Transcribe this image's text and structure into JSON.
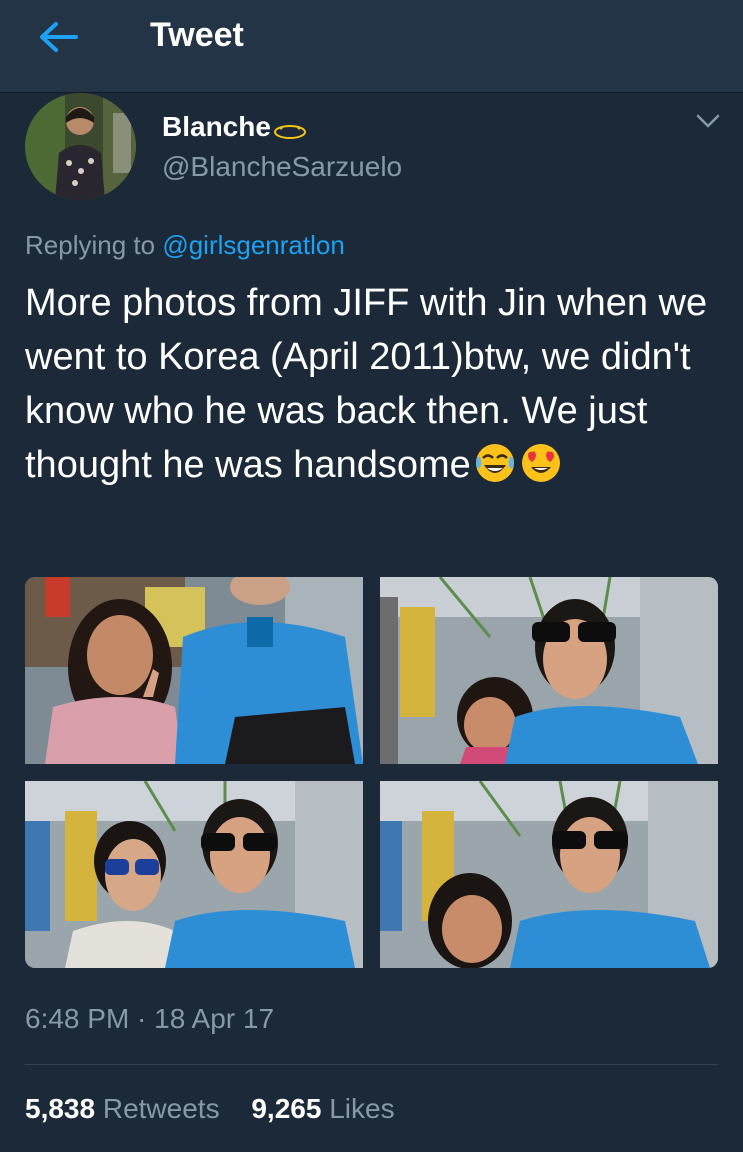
{
  "header": {
    "title": "Tweet",
    "back_icon": "arrow-left-icon",
    "accent": "#1da1f2"
  },
  "tweet": {
    "display_name": "Blanche",
    "name_icon": "halo-icon",
    "handle": "@BlancheSarzuelo",
    "replying_prefix": "Replying to",
    "replying_to": "@girlsgenratlon",
    "text": "More photos from JIFF with Jin when we went to Korea (April 2011)btw, we didn't know who he was back then. We just thought he was handsome",
    "emojis": [
      "tears-of-joy-emoji",
      "heart-eyes-emoji"
    ],
    "photos": [
      "photo-1",
      "photo-2",
      "photo-3",
      "photo-4"
    ],
    "timestamp": "6:48 PM · 18 Apr 17",
    "retweets_count": "5,838",
    "retweets_label": "Retweets",
    "likes_count": "9,265",
    "likes_label": "Likes"
  },
  "colors": {
    "background": "#1c2938",
    "topbar": "#243447",
    "secondary_text": "#8899a6",
    "link": "#1da1f2"
  }
}
